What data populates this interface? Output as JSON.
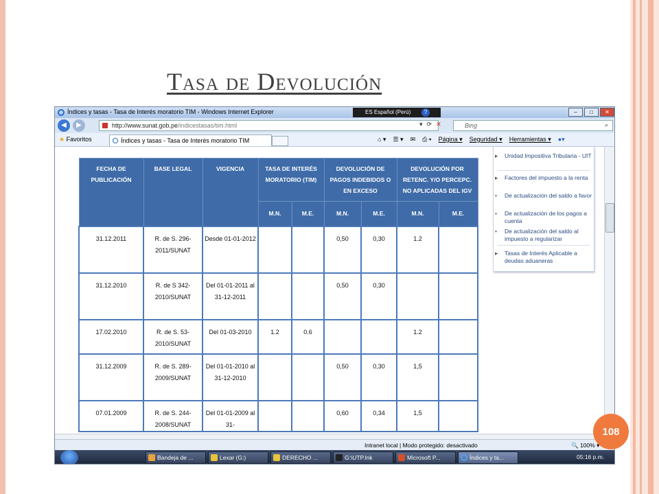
{
  "slide": {
    "title": "Tasa de Devolución",
    "page_number": "108"
  },
  "browser": {
    "window_title": "Índices y tasas - Tasa de Interés moratorio TIM - Windows Internet Explorer",
    "language": "ES Español (Perú)",
    "url_host": "http://www.sunat.gob.pe",
    "url_path": "/indicestasas/tim.html",
    "search_placeholder": "Bing",
    "favorites_label": "Favoritos",
    "tab_label": "Índices y tasas - Tasa de Interés moratorio TIM",
    "commands": [
      "Página ▾",
      "Seguridad ▾",
      "Herramientas ▾"
    ],
    "status_zone": "Intranet local | Modo protegido: desactivado",
    "zoom": "100%"
  },
  "table": {
    "headers": [
      "FECHA DE PUBLICACIÓN",
      "BASE LEGAL",
      "VIGENCIA",
      "TASA DE INTERÉS MORATORIO (TIM)",
      "DEVOLUCIÓN DE PAGOS INDEBIDOS O EN EXCESO",
      "DEVOLUCIÓN POR RETENC. Y/O PERCEPC. NO APLICADAS DEL IGV"
    ],
    "subheaders": [
      "M.N.",
      "M.E.",
      "M.N.",
      "M.E.",
      "M.N.",
      "M.E."
    ],
    "rows": [
      [
        "31.12.2011",
        "R. de S. 296-2011/SUNAT",
        "Desde 01-01-2012",
        "",
        "",
        "0,50",
        "0,30",
        "1.2",
        ""
      ],
      [
        "31.12.2010",
        "R. de S 342-2010/SUNAT",
        "Del 01-01-2011 al 31-12-2011",
        "",
        "",
        "0,50",
        "0,30",
        "",
        ""
      ],
      [
        "17.02.2010",
        "R. de S. 53-2010/SUNAT",
        "Del 01-03-2010",
        "1.2",
        "0.6",
        "",
        "",
        "1.2",
        ""
      ],
      [
        "31.12.2009",
        "R. de S. 289-2009/SUNAT",
        "Del 01-01-2010 al 31-12-2010",
        "",
        "",
        "0,50",
        "0,30",
        "1,5",
        ""
      ],
      [
        "07.01.2009",
        "R. de S. 244-2008/SUNAT",
        "Del 01-01-2009 al 31-",
        "",
        "",
        "0,60",
        "0,34",
        "1,5",
        ""
      ]
    ]
  },
  "sidebar": {
    "items": [
      {
        "label": "Unidad Impositiva Tributaria - UIT",
        "kind": "main"
      },
      {
        "label": "Factores del impuesto a la renta",
        "kind": "main"
      },
      {
        "label": "De actualización del saldo a favor",
        "kind": "sub"
      },
      {
        "label": "De actualización de los pagos a cuenta",
        "kind": "sub"
      },
      {
        "label": "De actualización del saldo al impuesto a regularizar",
        "kind": "sub"
      },
      {
        "label": "Tasas de Interés Aplicable a deudas aduaneras",
        "kind": "main"
      }
    ]
  },
  "taskbar": {
    "buttons": [
      "Bandeja de ...",
      "Lexar (G:)",
      "DERECHO ...",
      "G:\\UTP.lnk",
      "Microsoft P...",
      "Índices y ta..."
    ],
    "clock": "05:16 p.m."
  }
}
